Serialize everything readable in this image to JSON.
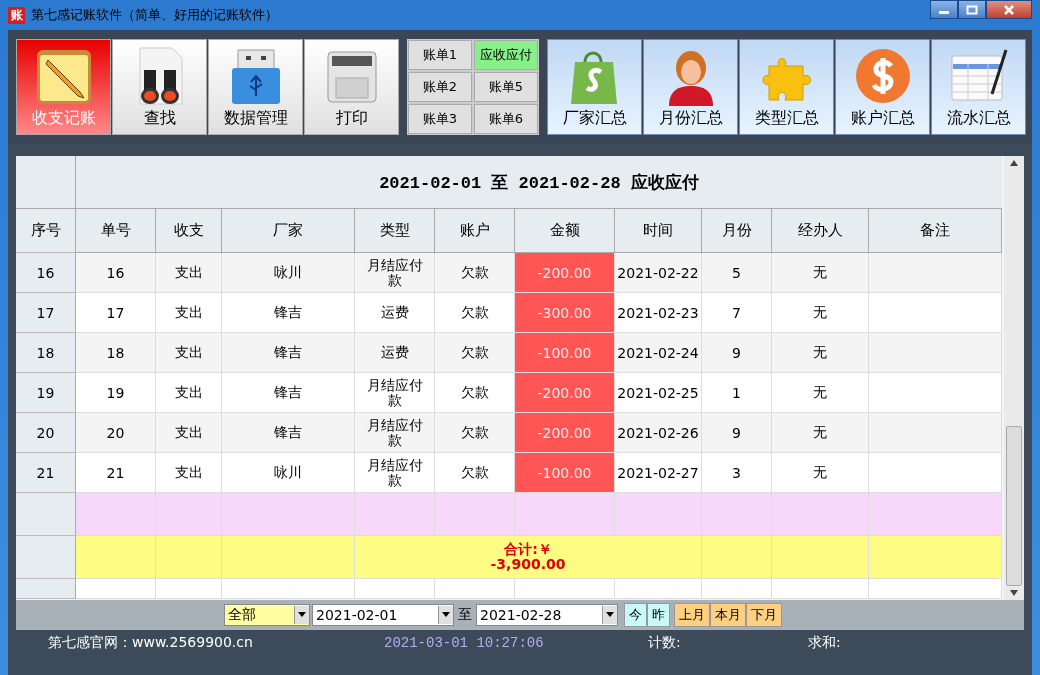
{
  "window": {
    "title": "第七感记账软件（简单、好用的记账软件）",
    "app_icon_text": "账"
  },
  "toolbar": [
    {
      "label": "收支记账",
      "selected": true
    },
    {
      "label": "查找",
      "selected": false
    },
    {
      "label": "数据管理",
      "selected": false
    },
    {
      "label": "打印",
      "selected": false
    }
  ],
  "ledger_tabs": [
    {
      "label": "账单1",
      "selected": false
    },
    {
      "label": "应收应付",
      "selected": true
    },
    {
      "label": "账单2",
      "selected": false
    },
    {
      "label": "账单5",
      "selected": false
    },
    {
      "label": "账单3",
      "selected": false
    },
    {
      "label": "账单6",
      "selected": false
    }
  ],
  "summary_buttons": [
    {
      "label": "厂家汇总"
    },
    {
      "label": "月份汇总"
    },
    {
      "label": "类型汇总"
    },
    {
      "label": "账户汇总"
    },
    {
      "label": "流水汇总"
    }
  ],
  "table": {
    "title": "2021-02-01  至  2021-02-28 应收应付",
    "columns": [
      "序号",
      "单号",
      "收支",
      "厂家",
      "类型",
      "账户",
      "金额",
      "时间",
      "月份",
      "经办人",
      "备注"
    ],
    "rows": [
      {
        "index": "16",
        "no": "16",
        "direction": "支出",
        "vendor": "咏川",
        "type": "月结应付款",
        "account": "欠款",
        "amount": "-200.00",
        "date": "2021-02-22",
        "month": "5",
        "handler": "无"
      },
      {
        "index": "17",
        "no": "17",
        "direction": "支出",
        "vendor": "锋吉",
        "type": "运费",
        "account": "欠款",
        "amount": "-300.00",
        "date": "2021-02-23",
        "month": "7",
        "handler": "无"
      },
      {
        "index": "18",
        "no": "18",
        "direction": "支出",
        "vendor": "锋吉",
        "type": "运费",
        "account": "欠款",
        "amount": "-100.00",
        "date": "2021-02-24",
        "month": "9",
        "handler": "无"
      },
      {
        "index": "19",
        "no": "19",
        "direction": "支出",
        "vendor": "锋吉",
        "type": "月结应付款",
        "account": "欠款",
        "amount": "-200.00",
        "date": "2021-02-25",
        "month": "1",
        "handler": "无"
      },
      {
        "index": "20",
        "no": "20",
        "direction": "支出",
        "vendor": "锋吉",
        "type": "月结应付款",
        "account": "欠款",
        "amount": "-200.00",
        "date": "2021-02-26",
        "month": "9",
        "handler": "无"
      },
      {
        "index": "21",
        "no": "21",
        "direction": "支出",
        "vendor": "咏川",
        "type": "月结应付款",
        "account": "欠款",
        "amount": "-100.00",
        "date": "2021-02-27",
        "month": "3",
        "handler": "无"
      }
    ],
    "total_label": "合计:￥",
    "total_value": "-3,900.00"
  },
  "filter": {
    "category": "全部",
    "from": "2021-02-01",
    "to_label": "至",
    "to": "2021-02-28",
    "day_buttons": [
      "今",
      "昨"
    ],
    "month_buttons": [
      "上月",
      "本月",
      "下月"
    ]
  },
  "status_bar": {
    "website": "第七感官网：www.2569900.cn",
    "datetime": "2021-03-01 10:27:06",
    "count_label": "计数:",
    "sum_label": "求和:"
  }
}
